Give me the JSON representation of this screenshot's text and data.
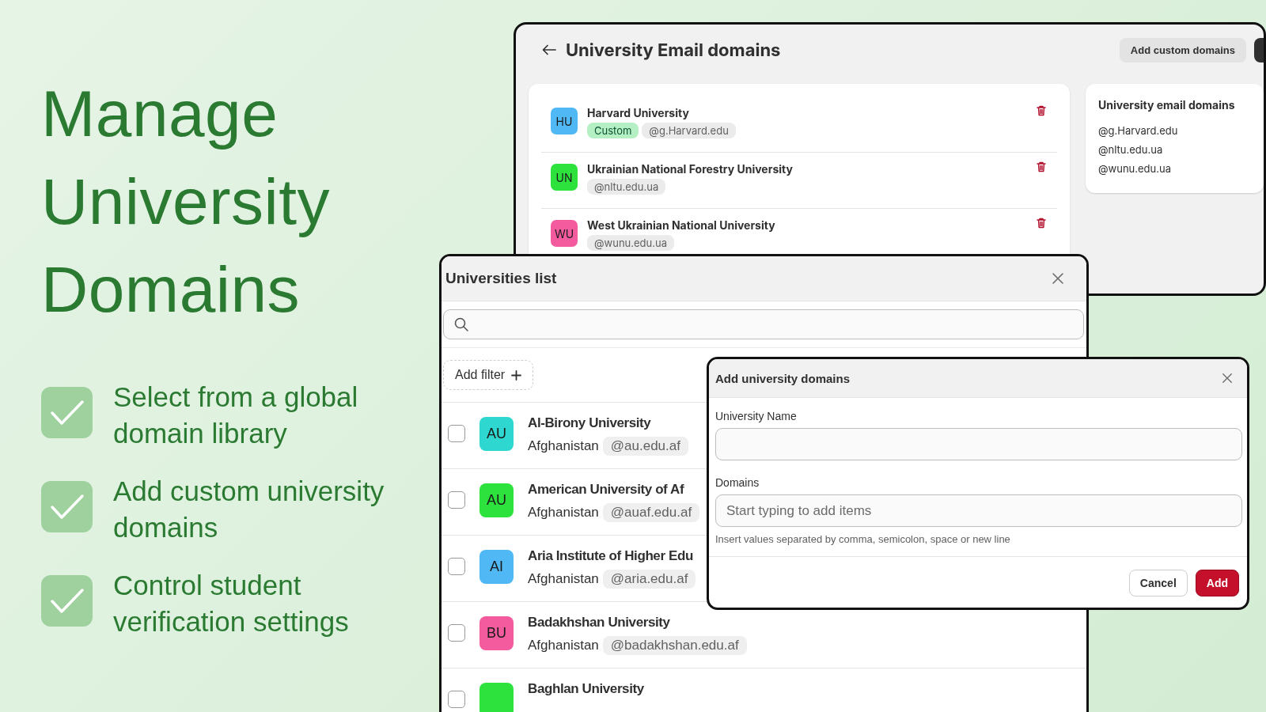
{
  "hero": {
    "title": "Manage University Domains",
    "features": [
      "Select from a global domain library",
      "Add custom university domains",
      "Control student verification settings"
    ]
  },
  "domains_page": {
    "title": "University Email domains",
    "buttons": [
      "Add custom domains"
    ],
    "universities": [
      {
        "initials": "HU",
        "color": "#4fb8f5",
        "name": "Harvard University",
        "tags": [
          {
            "label": "Custom",
            "kind": "custom"
          },
          {
            "label": "@g.Harvard.edu",
            "kind": "domain"
          }
        ]
      },
      {
        "initials": "UN",
        "color": "#2ee23e",
        "name": "Ukrainian National Forestry University",
        "tags": [
          {
            "label": "@nltu.edu.ua",
            "kind": "domain"
          }
        ]
      },
      {
        "initials": "WU",
        "color": "#f45b9e",
        "name": "West Ukrainian National University",
        "tags": [
          {
            "label": "@wunu.edu.ua",
            "kind": "domain"
          }
        ]
      }
    ],
    "sidebar": {
      "title": "University email domains",
      "domains": [
        "@g.Harvard.edu",
        "@nltu.edu.ua",
        "@wunu.edu.ua"
      ]
    }
  },
  "universities_modal": {
    "title": "Universities list",
    "add_filter": "Add filter",
    "rows": [
      {
        "initials": "AU",
        "color": "#2ed8d0",
        "name": "Al-Birony University",
        "country": "Afghanistan",
        "domain": "@au.edu.af",
        "checked": false
      },
      {
        "initials": "AU",
        "color": "#2ee23e",
        "name": "American University of Af",
        "country": "Afghanistan",
        "domain": "@auaf.edu.af",
        "checked": false
      },
      {
        "initials": "AI",
        "color": "#4fb8f5",
        "name": "Aria Institute of Higher Edu",
        "country": "Afghanistan",
        "domain": "@aria.edu.af",
        "checked": false
      },
      {
        "initials": "BU",
        "color": "#f45b9e",
        "name": "Badakhshan University",
        "country": "Afghanistan",
        "domain": "@badakhshan.edu.af",
        "checked": false
      },
      {
        "color": "#2ee23e",
        "name": "Baghlan University",
        "checked": false
      }
    ]
  },
  "add_modal": {
    "title": "Add university domains",
    "fields": [
      {
        "label": "University Name"
      },
      {
        "label": "Domains",
        "placeholder": "Start typing to add items"
      }
    ],
    "help": "Insert values separated by comma, semicolon, space or new line",
    "buttons": [
      {
        "label": "Cancel",
        "kind": "secondary"
      },
      {
        "label": "Add",
        "kind": "primary"
      }
    ]
  }
}
